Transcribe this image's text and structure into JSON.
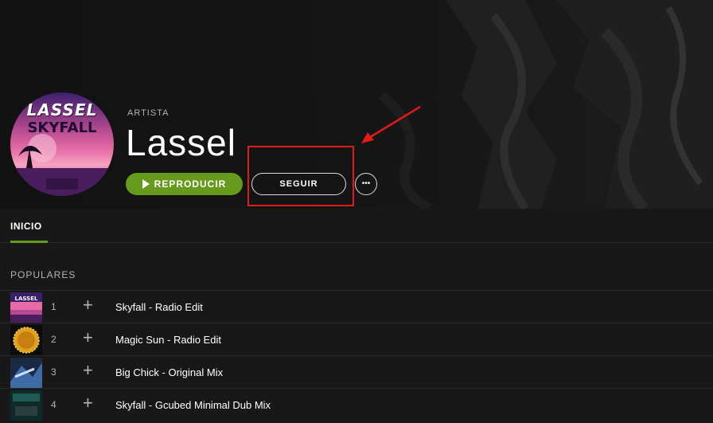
{
  "artist": {
    "type_label": "ARTISTA",
    "name": "Lassel",
    "avatar_text_top": "LASSEL",
    "avatar_text_bottom": "SKYFALL"
  },
  "actions": {
    "play_label": "REPRODUCIR",
    "follow_label": "SEGUIR",
    "more_label": "•••"
  },
  "tabs": [
    {
      "label": "INICIO",
      "active": true
    }
  ],
  "section": {
    "title": "POPULARES"
  },
  "tracks": [
    {
      "number": "1",
      "add": "+",
      "title": "Skyfall - Radio Edit"
    },
    {
      "number": "2",
      "add": "+",
      "title": "Magic Sun - Radio Edit"
    },
    {
      "number": "3",
      "add": "+",
      "title": "Big Chick - Original Mix"
    },
    {
      "number": "4",
      "add": "+",
      "title": "Skyfall - Gcubed Minimal Dub Mix"
    }
  ],
  "colors": {
    "accent_green": "#659a1c",
    "annotation_red": "#e11a1a",
    "background": "#181818"
  }
}
